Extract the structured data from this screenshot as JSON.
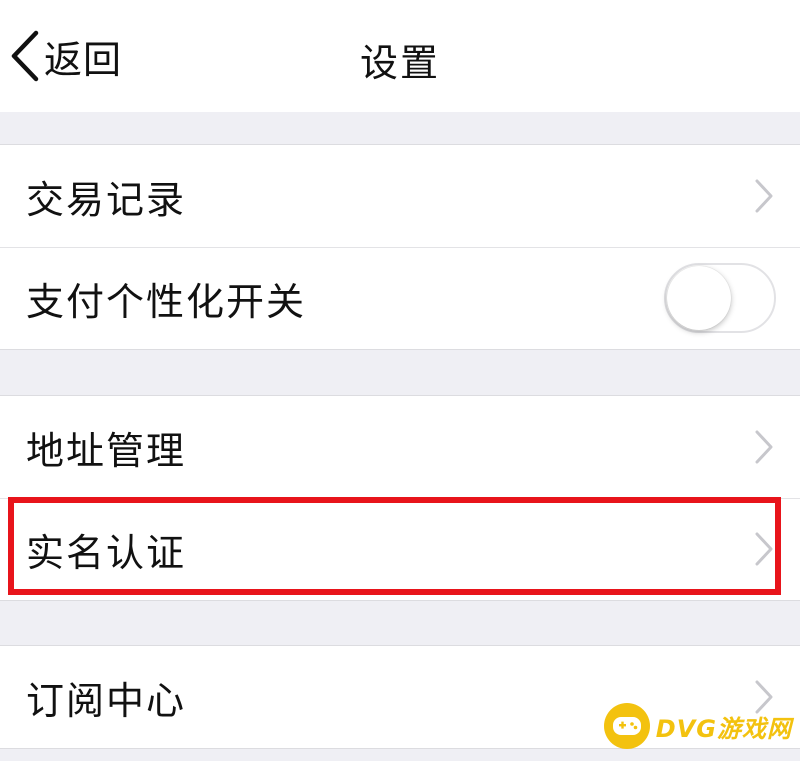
{
  "navbar": {
    "back_label": "返回",
    "title": "设置"
  },
  "groups": [
    {
      "items": [
        {
          "label": "交易记录",
          "control": "chevron"
        },
        {
          "label": "支付个性化开关",
          "control": "toggle",
          "toggle_on": false
        }
      ]
    },
    {
      "items": [
        {
          "label": "地址管理",
          "control": "chevron"
        },
        {
          "label": "实名认证",
          "control": "chevron",
          "highlighted": true
        }
      ]
    },
    {
      "items": [
        {
          "label": "订阅中心",
          "control": "chevron"
        }
      ]
    }
  ],
  "watermark": {
    "text": "DVG游戏网"
  },
  "colors": {
    "highlight": "#e8141b",
    "background": "#efeff4",
    "watermark": "#f3c20f"
  },
  "icons": {
    "back": "chevron-left-icon",
    "disclosure": "chevron-right-icon",
    "watermark_logo": "gamepad-icon"
  }
}
